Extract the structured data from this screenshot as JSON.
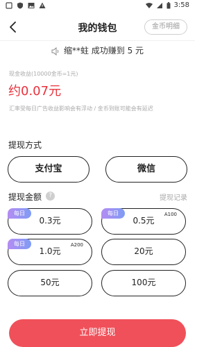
{
  "status_bar": {
    "time": "3:58"
  },
  "header": {
    "title": "我的钱包",
    "gold_detail_label": "金币明细"
  },
  "notice": {
    "text": "缩**蛀  成功赚到 5 元"
  },
  "balance": {
    "label": "现金收益(10000金币=1元)",
    "value": "约0.07元",
    "rate_note": "汇率受每日广告收益影响会有浮动 / 金币到账可能会有延迟"
  },
  "withdraw_method": {
    "title": "提现方式",
    "options": [
      "支付宝",
      "微信"
    ]
  },
  "withdraw_amount": {
    "title": "提现金额",
    "help": "?",
    "record_label": "提现记录",
    "daily_badge": "每日",
    "options": [
      {
        "label": "0.3元",
        "daily": true,
        "tag": ""
      },
      {
        "label": "0.5元",
        "daily": true,
        "tag": "A100"
      },
      {
        "label": "1.0元",
        "daily": true,
        "tag": "A200"
      },
      {
        "label": "20元",
        "daily": false,
        "tag": ""
      },
      {
        "label": "50元",
        "daily": false,
        "tag": ""
      },
      {
        "label": "100元",
        "daily": false,
        "tag": ""
      }
    ]
  },
  "submit_label": "立即提现",
  "colors": {
    "accent": "#e8323c",
    "button": "#f0505a",
    "badge_start": "#b48cf2",
    "badge_end": "#7e9cf5"
  }
}
